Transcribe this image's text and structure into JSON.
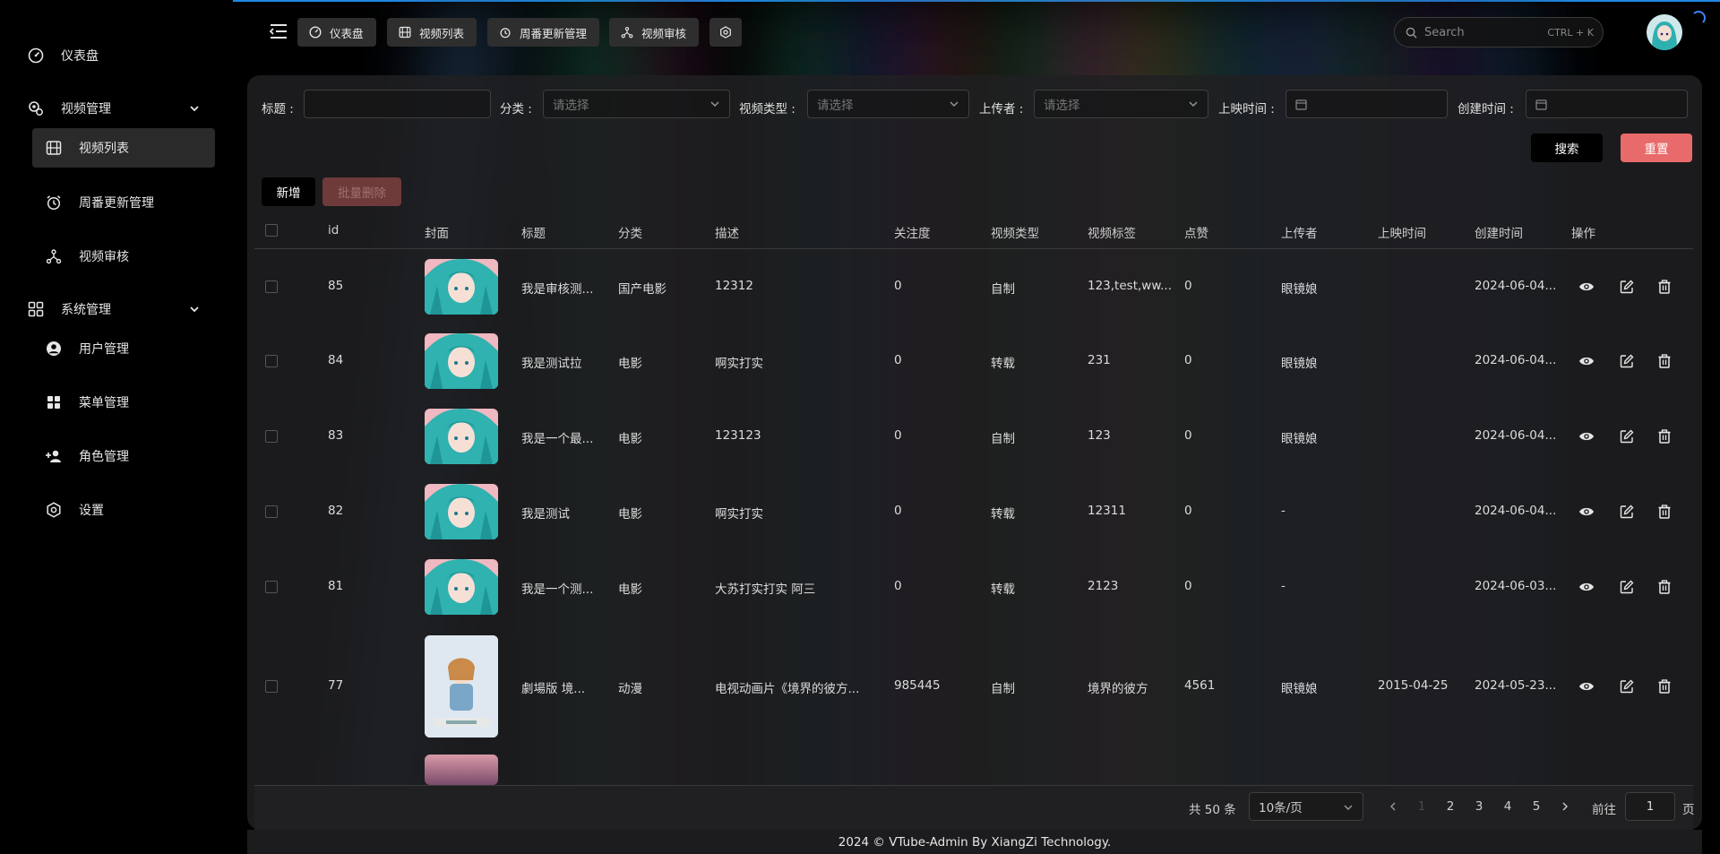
{
  "sidebar": {
    "dashboard": "仪表盘",
    "video_group": "视频管理",
    "video_list": "视频列表",
    "weekly_update": "周番更新管理",
    "video_review": "视频审核",
    "system_group": "系统管理",
    "user_mgmt": "用户管理",
    "menu_mgmt": "菜单管理",
    "role_mgmt": "角色管理",
    "settings": "设置"
  },
  "tabs": {
    "dashboard": "仪表盘",
    "video_list": "视频列表",
    "weekly_update": "周番更新管理",
    "video_review": "视频审核"
  },
  "search": {
    "placeholder": "Search",
    "shortcut": "CTRL + K"
  },
  "filters": {
    "title_label": "标题 :",
    "category_label": "分类 :",
    "category_placeholder": "请选择",
    "type_label": "视频类型 :",
    "type_placeholder": "请选择",
    "uploader_label": "上传者 :",
    "uploader_placeholder": "请选择",
    "release_label": "上映时间 :",
    "created_label": "创建时间 :",
    "search_button": "搜索",
    "reset_button": "重置"
  },
  "actions": {
    "add": "新增",
    "batch_delete": "批量删除"
  },
  "table": {
    "headers": [
      "id",
      "封面",
      "标题",
      "分类",
      "描述",
      "关注度",
      "视频类型",
      "视频标签",
      "点赞",
      "上传者",
      "上映时间",
      "创建时间",
      "操作"
    ],
    "rows": [
      {
        "id": "85",
        "title": "我是审核测...",
        "category": "国产电影",
        "desc": "12312",
        "follow": "0",
        "type": "自制",
        "tags": "123,test,ww...",
        "likes": "0",
        "uploader": "眼镜娘",
        "release": "",
        "created": "2024-06-04..."
      },
      {
        "id": "84",
        "title": "我是测试拉",
        "category": "电影",
        "desc": "啊实打实",
        "follow": "0",
        "type": "转载",
        "tags": "231",
        "likes": "0",
        "uploader": "眼镜娘",
        "release": "",
        "created": "2024-06-04..."
      },
      {
        "id": "83",
        "title": "我是一个最...",
        "category": "电影",
        "desc": "123123",
        "follow": "0",
        "type": "自制",
        "tags": "123",
        "likes": "0",
        "uploader": "眼镜娘",
        "release": "",
        "created": "2024-06-04..."
      },
      {
        "id": "82",
        "title": "我是测试",
        "category": "电影",
        "desc": "啊实打实",
        "follow": "0",
        "type": "转载",
        "tags": "12311",
        "likes": "0",
        "uploader": "-",
        "release": "",
        "created": "2024-06-04..."
      },
      {
        "id": "81",
        "title": "我是一个测...",
        "category": "电影",
        "desc": "大苏打实打实 阿三",
        "follow": "0",
        "type": "转载",
        "tags": "2123",
        "likes": "0",
        "uploader": "-",
        "release": "",
        "created": "2024-06-03..."
      },
      {
        "id": "77",
        "title": "劇場版 境...",
        "category": "动漫",
        "desc": "电视动画片《境界的彼方...",
        "follow": "985445",
        "type": "自制",
        "tags": "境界的彼方",
        "likes": "4561",
        "uploader": "眼镜娘",
        "release": "2015-04-25",
        "created": "2024-05-23..."
      }
    ]
  },
  "pagination": {
    "total": "共 50 条",
    "page_size": "10条/页",
    "pages": [
      "1",
      "2",
      "3",
      "4",
      "5"
    ],
    "current": "1",
    "goto_label": "前往",
    "goto_value": "1",
    "page_suffix": "页"
  },
  "footer": "2024 © VTube-Admin By XiangZi Technology.",
  "colors": {
    "accent_blue": "#1e88e5",
    "reset_red": "#e85d5d",
    "panel_bg": "#202022"
  }
}
